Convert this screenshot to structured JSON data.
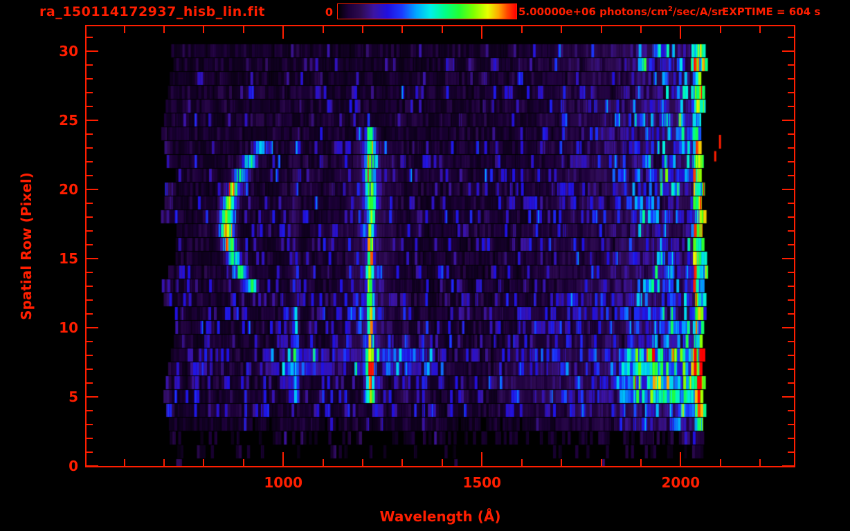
{
  "window": {
    "background": "#000000",
    "accent_color": "#ff1e00"
  },
  "header": {
    "filename": "ra_150114172937_hisb_lin.fit",
    "exptime": "EXPTIME = 604 s"
  },
  "colorbar": {
    "min_label": "0",
    "max_value_label": "5.00000e+06",
    "units_prefix": " photons/cm",
    "units_sup": "2",
    "units_suffix": "/sec/A/sr"
  },
  "chart_data": {
    "type": "heatmap",
    "title": "ra_150114172937_hisb_lin.fit",
    "xlabel": "Wavelength (Å)",
    "ylabel": "Spatial Row (Pixel)",
    "xlim": [
      505,
      2285
    ],
    "ylim": [
      0,
      31.8
    ],
    "x_major_ticks": [
      1000,
      1500,
      2000
    ],
    "x_major_tick_labels": [
      "1000",
      "1500",
      "2000"
    ],
    "x_minor_tick_step": 100,
    "x_minor_tick_range": [
      600,
      2200
    ],
    "y_major_ticks": [
      0,
      5,
      10,
      15,
      20,
      25,
      30
    ],
    "y_major_tick_labels": [
      "0",
      "5",
      "10",
      "15",
      "20",
      "25",
      "30"
    ],
    "y_minor_tick_step": 1,
    "colorbar_range_photons": [
      0,
      5000000
    ],
    "colorbar_units": "photons/cm2/sec/A/sr",
    "exposure_time_s": 604,
    "data_extent": {
      "wavelength_A": [
        688,
        2066
      ],
      "rows": [
        0,
        30
      ]
    },
    "noise_seed": 20150114,
    "bin_width_A": 7,
    "colormap_stops": [
      [
        0.0,
        "#000000"
      ],
      [
        0.06,
        "#1c0038"
      ],
      [
        0.13,
        "#2e0b52"
      ],
      [
        0.2,
        "#3c14a0"
      ],
      [
        0.28,
        "#2010e0"
      ],
      [
        0.36,
        "#1b3cff"
      ],
      [
        0.44,
        "#00a8ff"
      ],
      [
        0.52,
        "#00f0e8"
      ],
      [
        0.6,
        "#00ff88"
      ],
      [
        0.68,
        "#22ff33"
      ],
      [
        0.76,
        "#7fff00"
      ],
      [
        0.84,
        "#e8ff00"
      ],
      [
        0.9,
        "#ffa800"
      ],
      [
        0.95,
        "#ff4400"
      ],
      [
        1.0,
        "#ff0000"
      ]
    ],
    "features": {
      "arc": {
        "name": "curved-streak",
        "vertex_wavelength_A": 854,
        "center_row": 17.5,
        "curvature_A_per_row2": 2.9,
        "row_range": [
          13,
          23
        ],
        "width_A": 17,
        "peak_intensity": 0.73,
        "tip_fade_per_row": 0.055
      },
      "emission_lines": [
        {
          "name": "left-edge-glow",
          "wavelength_A": 705,
          "row_range": [
            4,
            23
          ],
          "intensity": 0.13,
          "width_A": 6
        },
        {
          "name": "H-Lyman-beta-1026",
          "wavelength_A": 1026,
          "row_range": [
            5,
            11
          ],
          "intensity": 0.3,
          "width_A": 9
        },
        {
          "name": "H-Lyman-beta-1026-upper",
          "wavelength_A": 1026,
          "row_range": [
            12,
            23
          ],
          "intensity": 0.11,
          "width_A": 8
        },
        {
          "name": "H-Lyman-alpha-1216-lower",
          "wavelength_A": 1216,
          "row_range": [
            5,
            8
          ],
          "intensity": 0.74,
          "width_A": 11
        },
        {
          "name": "H-Lyman-alpha-1216-mid",
          "wavelength_A": 1216,
          "row_range": [
            9,
            18
          ],
          "intensity": 0.62,
          "width_A": 8
        },
        {
          "name": "H-Lyman-alpha-1216-upper",
          "wavelength_A": 1216,
          "row_range": [
            19,
            24
          ],
          "intensity": 0.56,
          "width_A": 13
        },
        {
          "name": "Lyman-alpha-halo",
          "wavelength_A": 1216,
          "row_range": [
            9,
            23
          ],
          "intensity": 0.12,
          "width_A": 45
        },
        {
          "name": "O-I-1304",
          "wavelength_A": 1304,
          "row_range": [
            5,
            12
          ],
          "intensity": 0.1,
          "width_A": 8
        },
        {
          "name": "line-1356",
          "wavelength_A": 1356,
          "row_range": [
            5,
            10
          ],
          "intensity": 0.07,
          "width_A": 7
        }
      ],
      "bright_band": {
        "rows": [
          7,
          8
        ],
        "wavelength_range_A": [
          940,
          1400
        ],
        "intensity": 0.18
      },
      "lower_right_band": {
        "rows": [
          5,
          8
        ],
        "start_wavelength_A": 1530,
        "strong_wavelength_A": 1840,
        "intensity": 0.2
      },
      "right_edge_brightening": {
        "start_wavelength_A": 1600,
        "edge_wavelength_A": 2030,
        "edge_intensity": 0.45,
        "hot_cell_fraction": 0.1
      },
      "hot_pixels": [
        {
          "wavelength_A": 2099,
          "row_center": 23.45,
          "row_span": 1.0
        },
        {
          "wavelength_A": 2087,
          "row_center": 22.4,
          "row_span": 0.75
        }
      ]
    }
  }
}
